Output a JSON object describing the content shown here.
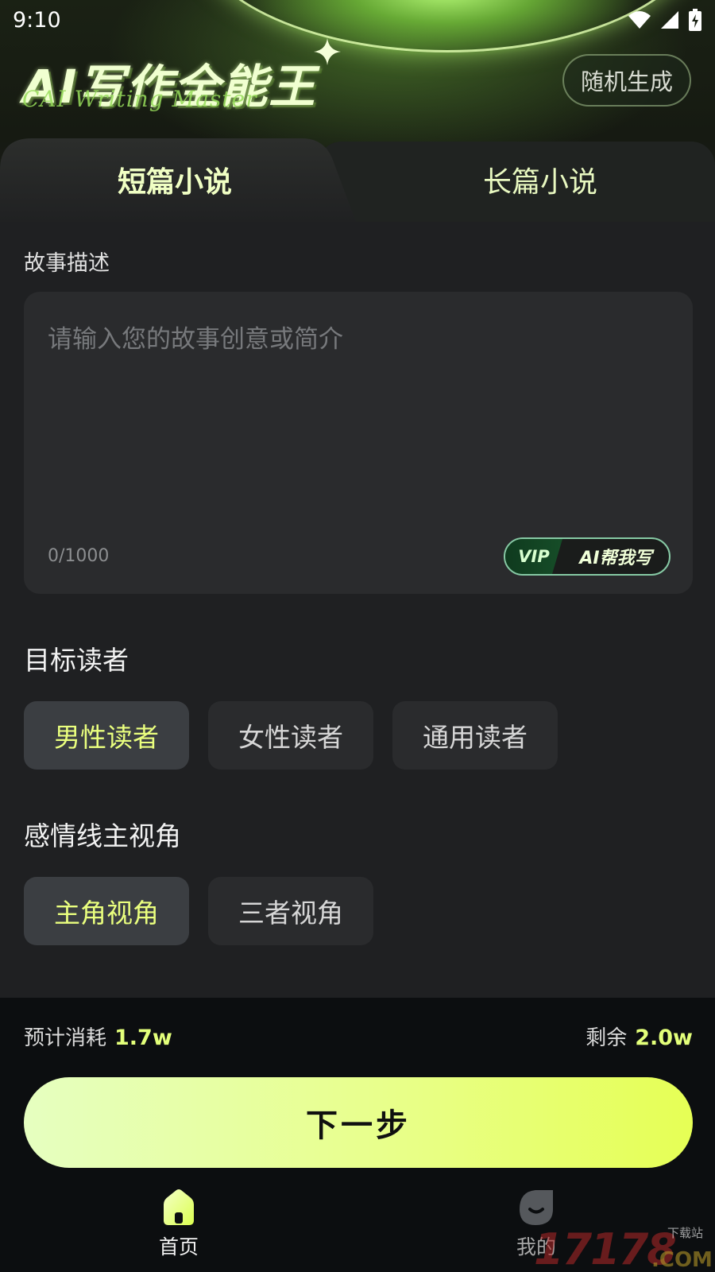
{
  "status_bar": {
    "time": "9:10"
  },
  "header": {
    "logo_title": "AI写作全能王",
    "logo_subtitle": "CAI Writing Master",
    "random_button": "随机生成"
  },
  "tabs": [
    {
      "label": "短篇小说",
      "active": true
    },
    {
      "label": "长篇小说",
      "active": false
    }
  ],
  "story": {
    "section_label": "故事描述",
    "placeholder": "请输入您的故事创意或简介",
    "value": "",
    "counter": "0/1000",
    "vip_badge": "VIP",
    "ai_help_button": "AI帮我写"
  },
  "target_reader": {
    "title": "目标读者",
    "options": [
      {
        "label": "男性读者",
        "selected": true
      },
      {
        "label": "女性读者",
        "selected": false
      },
      {
        "label": "通用读者",
        "selected": false
      }
    ]
  },
  "perspective": {
    "title": "感情线主视角",
    "options": [
      {
        "label": "主角视角",
        "selected": true
      },
      {
        "label": "三者视角",
        "selected": false
      }
    ]
  },
  "cost": {
    "estimate_label": "预计消耗",
    "estimate_value": "1.7w",
    "remaining_label": "剩余",
    "remaining_value": "2.0w"
  },
  "next_button": "下一步",
  "bottom_nav": [
    {
      "label": "首页",
      "icon": "home-icon",
      "active": true
    },
    {
      "label": "我的",
      "icon": "profile-icon",
      "active": false
    }
  ],
  "watermark": {
    "main": "17178",
    "sub": "下载站",
    "domain": ".COM"
  },
  "colors": {
    "accent": "#e6ff55",
    "selected_text": "#eaff7e",
    "background": "#1f2022",
    "bottom_background": "#0c0e10"
  }
}
